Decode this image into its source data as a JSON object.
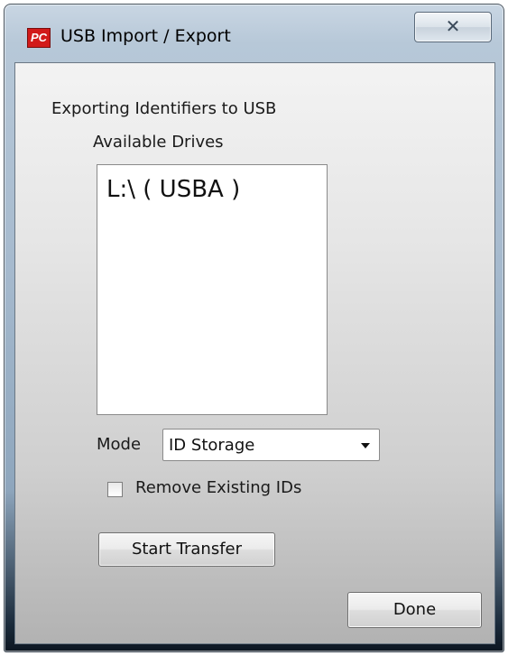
{
  "window": {
    "title": "USB Import / Export",
    "app_icon_text": "PC",
    "close_glyph": "✕"
  },
  "main": {
    "header": "Exporting Identifiers to USB",
    "drives_label": "Available Drives",
    "drives": [
      {
        "label": "L:\\ ( USBA )"
      }
    ],
    "mode_label": "Mode",
    "mode_value": "ID Storage",
    "remove_checkbox_label": "Remove Existing IDs",
    "remove_checked": false,
    "start_button": "Start Transfer",
    "done_button": "Done"
  },
  "icons": {
    "app": "pc-app-icon",
    "close": "close-icon",
    "dropdown": "chevron-down-icon"
  }
}
